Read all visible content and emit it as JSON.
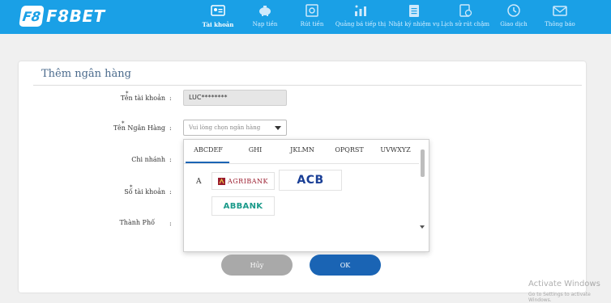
{
  "brand": {
    "logo_mark": "F8",
    "name": "F8BET"
  },
  "nav": [
    {
      "label": "Tài khoản",
      "icon": "account-card-icon",
      "active": true
    },
    {
      "label": "Nạp tiền",
      "icon": "piggy-bank-icon",
      "active": false
    },
    {
      "label": "Rút tiền",
      "icon": "safe-icon",
      "active": false
    },
    {
      "label": "Quảng bá tiếp thị",
      "icon": "promotion-icon",
      "active": false
    },
    {
      "label": "Nhật ký nhiệm vụ",
      "icon": "task-log-icon",
      "active": false
    },
    {
      "label": "Lịch sử rút chậm",
      "icon": "history-icon",
      "active": false
    },
    {
      "label": "Giao dịch",
      "icon": "clock-icon",
      "active": false
    },
    {
      "label": "Thông báo",
      "icon": "mail-icon",
      "active": false
    }
  ],
  "form": {
    "title": "Thêm ngân hàng",
    "account_name_label": "Tên tài khoản",
    "account_name_value": "LUC********",
    "bank_name_label": "Tên Ngân Hàng",
    "bank_select_placeholder": "Vui lòng chọn ngân hàng",
    "branch_label": "Chi nhánh",
    "account_number_label": "Số tài khoản",
    "city_label": "Thành Phố",
    "colon": ":",
    "required_mark": "*"
  },
  "dropdown": {
    "tabs": [
      "ABCDEF",
      "GHI",
      "JKLMN",
      "OPQRST",
      "UVWXYZ"
    ],
    "active_tab": "ABCDEF",
    "group_letter": "A",
    "banks": [
      "AGRIBANK",
      "ACB",
      "ABBANK"
    ]
  },
  "buttons": {
    "cancel": "Hủy",
    "ok": "OK"
  },
  "watermark": {
    "title": "Activate Windows",
    "subtitle": "Go to Settings to activate Windows."
  },
  "colors": {
    "header": "#1aa0e6",
    "primary_button": "#1a64b4",
    "cancel_button": "#a9a9a9",
    "agribank": "#9b1c2e",
    "acb": "#1a3f96",
    "abbank": "#1b9a8a"
  }
}
